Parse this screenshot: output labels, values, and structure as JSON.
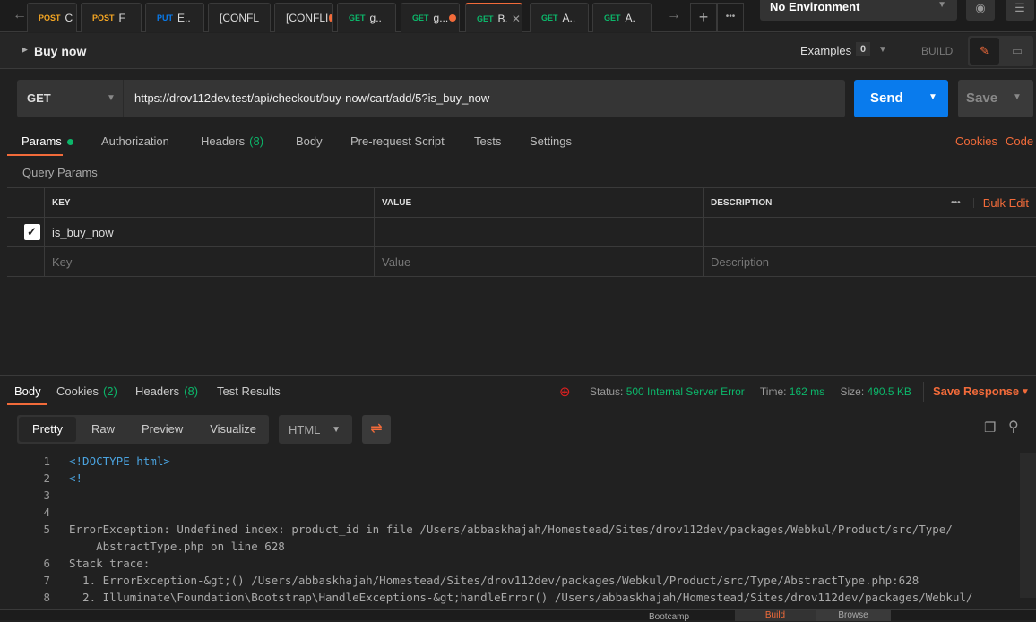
{
  "tabs": [
    {
      "method": "POST",
      "name": "C",
      "color": "#f5a623"
    },
    {
      "method": "POST",
      "name": "F",
      "color": "#f5a623"
    },
    {
      "method": "PUT",
      "name": "E..",
      "color": "#097bed"
    },
    {
      "method": "",
      "name": "[CONFL",
      "color": "#ddd"
    },
    {
      "method": "",
      "name": "[CONFLI",
      "color": "#ddd",
      "dot": true
    },
    {
      "method": "GET",
      "name": "g..",
      "color": "#0cb66a"
    },
    {
      "method": "GET",
      "name": "g...",
      "color": "#0cb66a",
      "dot": true
    },
    {
      "method": "GET",
      "name": "B.",
      "color": "#0cb66a",
      "active": true
    },
    {
      "method": "GET",
      "name": "A..",
      "color": "#0cb66a"
    },
    {
      "method": "GET",
      "name": "A.",
      "color": "#0cb66a"
    }
  ],
  "environment": "No Environment",
  "request": {
    "name": "Buy now",
    "examples_label": "Examples",
    "examples_count": "0",
    "build_label": "BUILD",
    "method": "GET",
    "url": "https://drov112dev.test/api/checkout/buy-now/cart/add/5?is_buy_now",
    "send": "Send",
    "save": "Save"
  },
  "request_tabs": [
    {
      "label": "Params",
      "dot": true
    },
    {
      "label": "Authorization"
    },
    {
      "label": "Headers",
      "count": "(8)"
    },
    {
      "label": "Body"
    },
    {
      "label": "Pre-request Script"
    },
    {
      "label": "Tests"
    },
    {
      "label": "Settings"
    }
  ],
  "links": {
    "cookies": "Cookies",
    "code": "Code"
  },
  "query_params": {
    "title": "Query Params",
    "headers": [
      "KEY",
      "VALUE",
      "DESCRIPTION"
    ],
    "bulk_edit": "Bulk Edit",
    "rows": [
      {
        "checked": true,
        "key": "is_buy_now",
        "value": "",
        "description": ""
      }
    ],
    "placeholders": {
      "key": "Key",
      "value": "Value",
      "description": "Description"
    }
  },
  "response": {
    "tabs": [
      {
        "label": "Body"
      },
      {
        "label": "Cookies",
        "count": "(2)"
      },
      {
        "label": "Headers",
        "count": "(8)"
      },
      {
        "label": "Test Results"
      }
    ],
    "status_label": "Status:",
    "status": "500 Internal Server Error",
    "time_label": "Time:",
    "time": "162 ms",
    "size_label": "Size:",
    "size": "490.5 KB",
    "save_response": "Save Response",
    "views": [
      "Pretty",
      "Raw",
      "Preview",
      "Visualize"
    ],
    "format": "HTML",
    "lines": [
      {
        "n": "1",
        "t": "<!DOCTYPE html>"
      },
      {
        "n": "2",
        "t": "<!--"
      },
      {
        "n": "3",
        "t": ""
      },
      {
        "n": "4",
        "t": ""
      },
      {
        "n": "5",
        "t": "ErrorException: Undefined index: product_id in file /Users/abbaskhajah/Homestead/Sites/drov112dev/packages/Webkul/Product/src/Type/"
      },
      {
        "n": "",
        "t": "    AbstractType.php on line 628"
      },
      {
        "n": "6",
        "t": "Stack trace:"
      },
      {
        "n": "7",
        "t": "  1. ErrorException-&gt;() /Users/abbaskhajah/Homestead/Sites/drov112dev/packages/Webkul/Product/src/Type/AbstractType.php:628"
      },
      {
        "n": "8",
        "t": "  2. Illuminate\\Foundation\\Bootstrap\\HandleExceptions-&gt;handleError() /Users/abbaskhajah/Homestead/Sites/drov112dev/packages/Webkul/"
      }
    ]
  },
  "footer": {
    "bootcamp": "Bootcamp",
    "build": "Build",
    "browse": "Browse"
  }
}
